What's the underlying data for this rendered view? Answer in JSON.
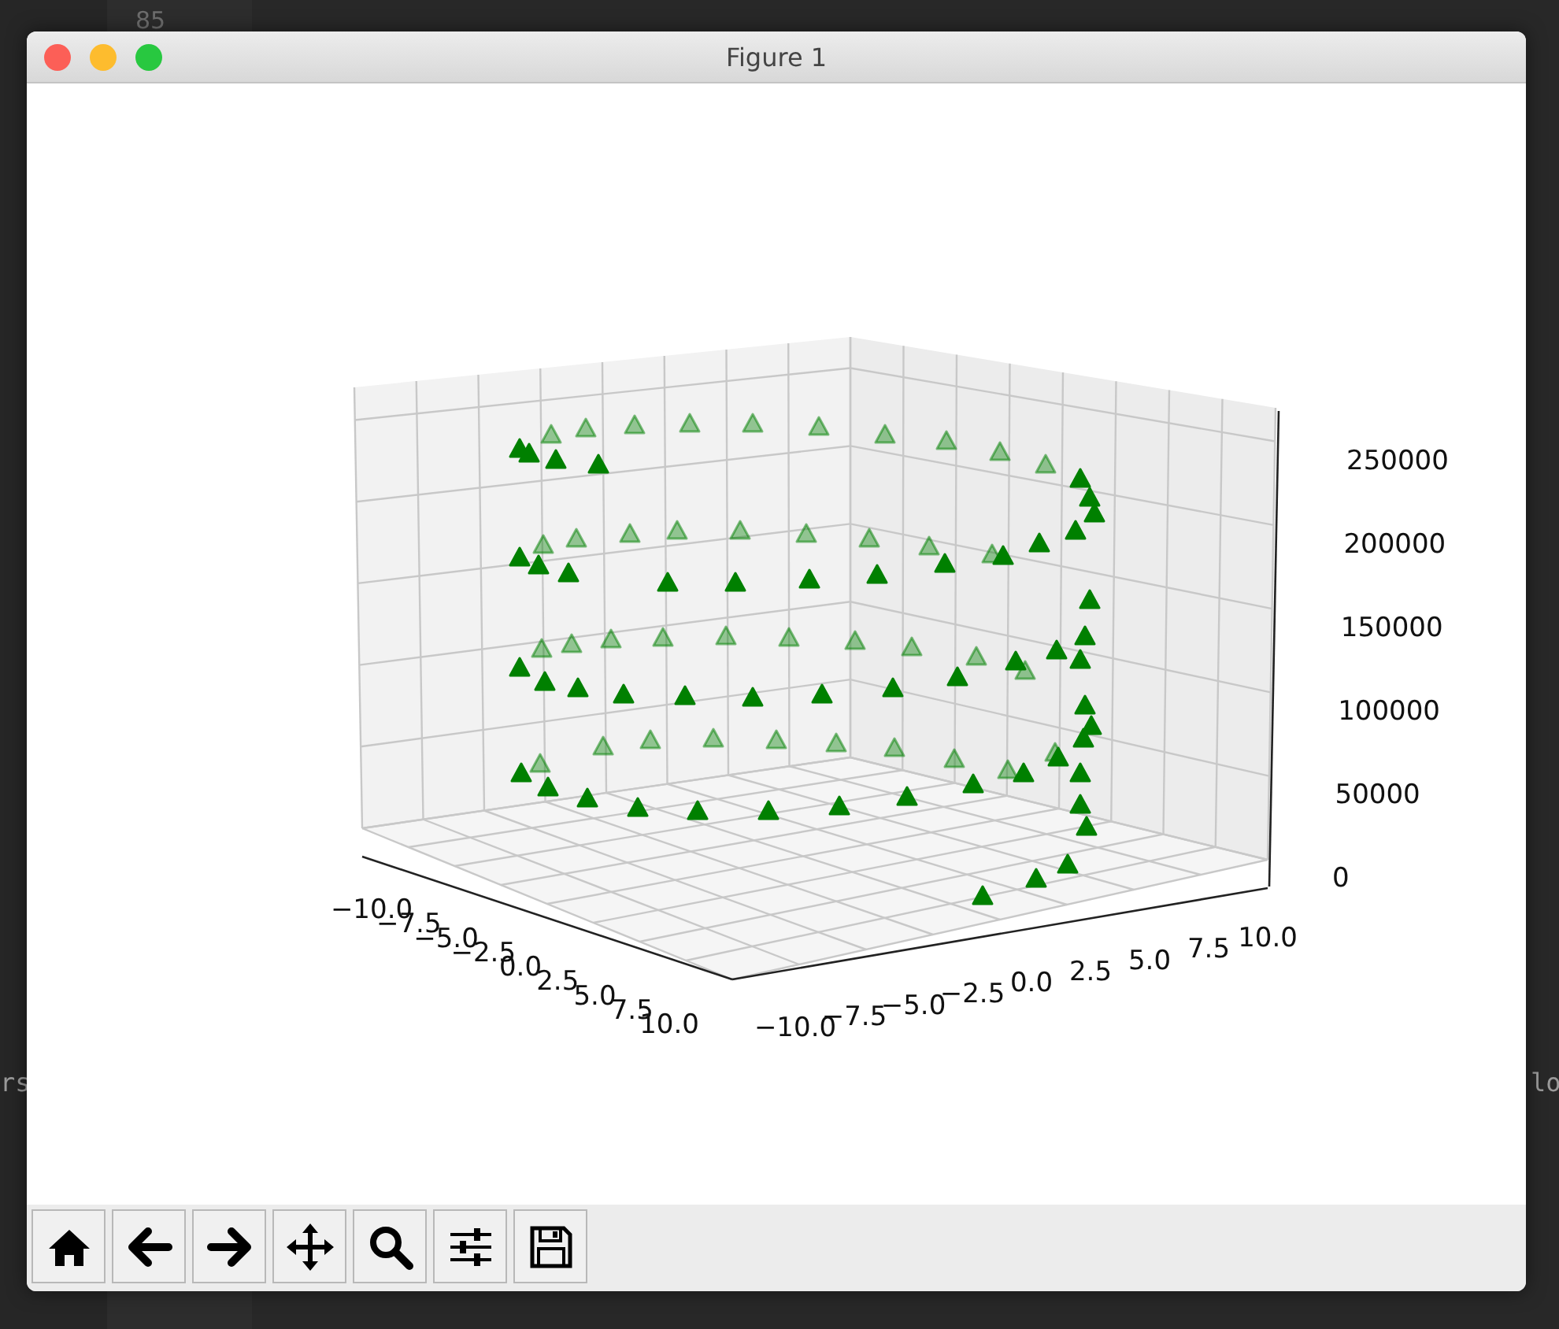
{
  "editor": {
    "line_number": "85",
    "left_fragment": "rs",
    "right_fragment": "lo"
  },
  "window": {
    "title": "Figure 1"
  },
  "plot": {
    "kind": "scatter3d",
    "x_ticks": [
      "−10.0",
      "−7.5",
      "−5.0",
      "−2.5",
      "0.0",
      "2.5",
      "5.0",
      "7.5",
      "10.0"
    ],
    "y_ticks": [
      "−10.0",
      "−7.5",
      "−5.0",
      "−2.5",
      "0.0",
      "2.5",
      "5.0",
      "7.5",
      "10.0"
    ],
    "z_ticks": [
      "250000",
      "200000",
      "150000",
      "100000",
      "50000",
      "0"
    ]
  },
  "toolbar": [
    {
      "kind": "home"
    },
    {
      "kind": "back"
    },
    {
      "kind": "forward"
    },
    {
      "kind": "pan"
    },
    {
      "kind": "zoom"
    },
    {
      "kind": "configure"
    },
    {
      "kind": "save"
    }
  ]
}
